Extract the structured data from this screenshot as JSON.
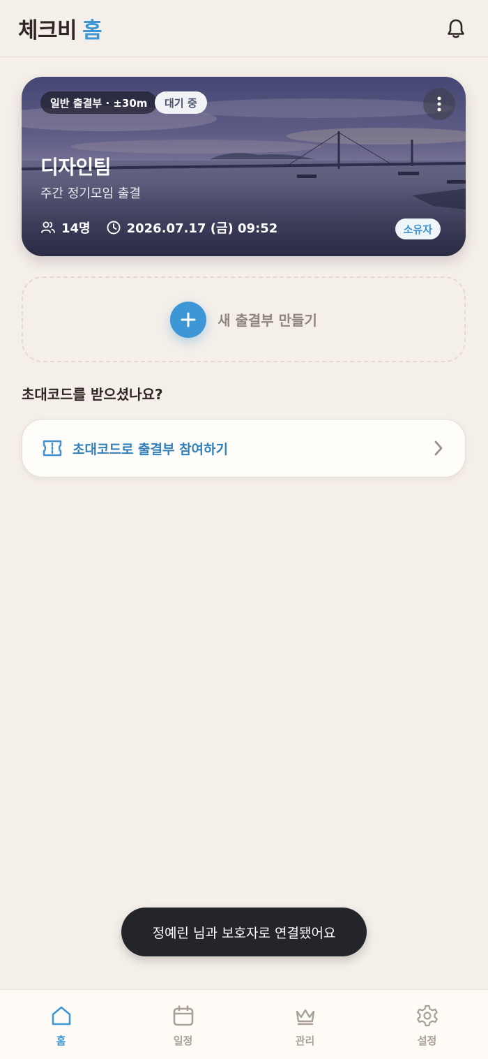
{
  "header": {
    "title_main": "체크비",
    "title_accent": "홈",
    "bell_icon": "bell-icon"
  },
  "card": {
    "type_chip": "일반 출결부 · ±30m",
    "status_chip": "대기 중",
    "title": "디자인팀",
    "subtitle": "주간 정기모임 출결",
    "members": "14명",
    "datetime": "2026.07.17 (금) 09:52",
    "role_badge": "소유자",
    "more_icon": "more-vertical-icon"
  },
  "new_book": {
    "label": "새 출결부 만들기",
    "icon": "plus-icon"
  },
  "invite": {
    "question": "초대코드를 받으셨나요?",
    "join_label": "초대코드로 출결부 참여하기",
    "icon": "ticket-icon"
  },
  "toast": {
    "message": "정예린 님과 보호자로 연결됐어요"
  },
  "nav": {
    "items": [
      {
        "label": "홈",
        "icon": "home-icon",
        "active": true
      },
      {
        "label": "일정",
        "icon": "calendar-icon",
        "active": false
      },
      {
        "label": "관리",
        "icon": "crown-icon",
        "active": false
      },
      {
        "label": "설정",
        "icon": "gear-icon",
        "active": false
      }
    ]
  },
  "colors": {
    "accent": "#3d97d6",
    "background": "#f5efe9",
    "toast_bg": "#23252a"
  }
}
